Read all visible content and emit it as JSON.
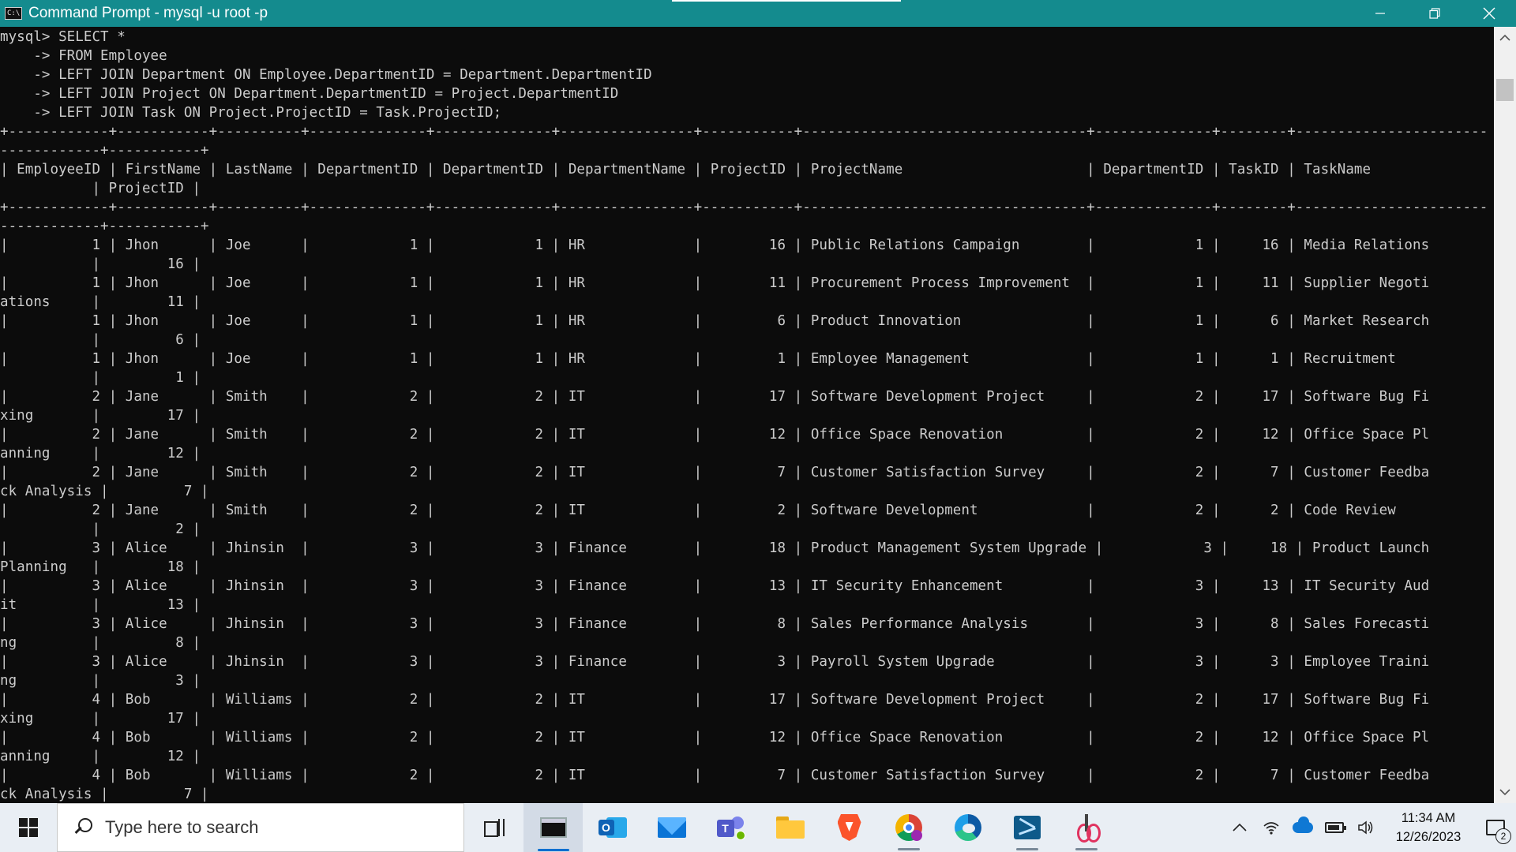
{
  "window": {
    "title": "Command Prompt - mysql  -u root -p",
    "app_icon_text": "C:\\"
  },
  "console_lines": [
    "mysql> SELECT *",
    "    -> FROM Employee",
    "    -> LEFT JOIN Department ON Employee.DepartmentID = Department.DepartmentID",
    "    -> LEFT JOIN Project ON Department.DepartmentID = Project.DepartmentID",
    "    -> LEFT JOIN Task ON Project.ProjectID = Task.ProjectID;",
    "+------------+-----------+----------+--------------+--------------+----------------+-----------+----------------------------------+--------------+--------+-----------------------",
    "------------+-----------+",
    "| EmployeeID | FirstName | LastName | DepartmentID | DepartmentID | DepartmentName | ProjectID | ProjectName                      | DepartmentID | TaskID | TaskName",
    "           | ProjectID |",
    "+------------+-----------+----------+--------------+--------------+----------------+-----------+----------------------------------+--------------+--------+-----------------------",
    "------------+-----------+",
    "|          1 | Jhon      | Joe      |            1 |            1 | HR             |        16 | Public Relations Campaign        |            1 |     16 | Media Relations",
    "           |        16 |",
    "|          1 | Jhon      | Joe      |            1 |            1 | HR             |        11 | Procurement Process Improvement  |            1 |     11 | Supplier Negoti",
    "ations     |        11 |",
    "|          1 | Jhon      | Joe      |            1 |            1 | HR             |         6 | Product Innovation               |            1 |      6 | Market Research",
    "           |         6 |",
    "|          1 | Jhon      | Joe      |            1 |            1 | HR             |         1 | Employee Management              |            1 |      1 | Recruitment",
    "           |         1 |",
    "|          2 | Jane      | Smith    |            2 |            2 | IT             |        17 | Software Development Project     |            2 |     17 | Software Bug Fi",
    "xing       |        17 |",
    "|          2 | Jane      | Smith    |            2 |            2 | IT             |        12 | Office Space Renovation          |            2 |     12 | Office Space Pl",
    "anning     |        12 |",
    "|          2 | Jane      | Smith    |            2 |            2 | IT             |         7 | Customer Satisfaction Survey     |            2 |      7 | Customer Feedba",
    "ck Analysis |         7 |",
    "|          2 | Jane      | Smith    |            2 |            2 | IT             |         2 | Software Development             |            2 |      2 | Code Review",
    "           |         2 |",
    "|          3 | Alice     | Jhinsin  |            3 |            3 | Finance        |        18 | Product Management System Upgrade |            3 |     18 | Product Launch",
    "Planning   |        18 |",
    "|          3 | Alice     | Jhinsin  |            3 |            3 | Finance        |        13 | IT Security Enhancement          |            3 |     13 | IT Security Aud",
    "it         |        13 |",
    "|          3 | Alice     | Jhinsin  |            3 |            3 | Finance        |         8 | Sales Performance Analysis       |            3 |      8 | Sales Forecasti",
    "ng         |         8 |",
    "|          3 | Alice     | Jhinsin  |            3 |            3 | Finance        |         3 | Payroll System Upgrade           |            3 |      3 | Employee Traini",
    "ng         |         3 |",
    "|          4 | Bob       | Williams |            2 |            2 | IT             |        17 | Software Development Project     |            2 |     17 | Software Bug Fi",
    "xing       |        17 |",
    "|          4 | Bob       | Williams |            2 |            2 | IT             |        12 | Office Space Renovation          |            2 |     12 | Office Space Pl",
    "anning     |        12 |",
    "|          4 | Bob       | Williams |            2 |            2 | IT             |         7 | Customer Satisfaction Survey     |            2 |      7 | Customer Feedba",
    "ck Analysis |         7 |"
  ],
  "taskbar": {
    "search_placeholder": "Type here to search",
    "apps": [
      {
        "name": "task-view-icon"
      },
      {
        "name": "command-prompt-icon"
      },
      {
        "name": "outlook-icon",
        "label": "O"
      },
      {
        "name": "mail-icon"
      },
      {
        "name": "teams-icon",
        "label": "T"
      },
      {
        "name": "file-explorer-icon"
      },
      {
        "name": "brave-browser-icon"
      },
      {
        "name": "chrome-icon"
      },
      {
        "name": "edge-icon"
      },
      {
        "name": "mysql-workbench-icon"
      },
      {
        "name": "snipping-tool-icon"
      }
    ],
    "clock": {
      "time": "11:34 AM",
      "date": "12/26/2023"
    },
    "notification_count": "2"
  },
  "colors": {
    "titlebar": "#148b8e",
    "console_bg": "#0c0c0c",
    "console_text": "#cccccc",
    "taskbar_bg": "#e9eef4"
  }
}
